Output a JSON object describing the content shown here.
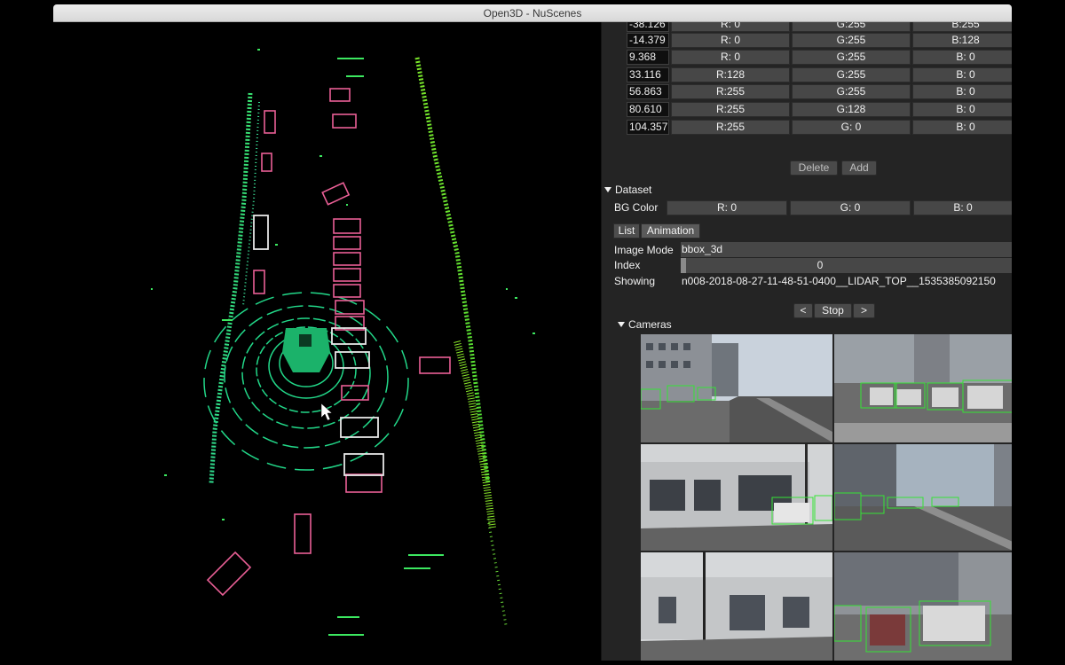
{
  "window": {
    "title": "Open3D - NuScenes"
  },
  "colormap": {
    "points": [
      {
        "value": "-38.126",
        "r": "R:  0",
        "g": "G:255",
        "b": "B:255"
      },
      {
        "value": "-14.379",
        "r": "R:  0",
        "g": "G:255",
        "b": "B:128"
      },
      {
        "value": "9.368",
        "r": "R:  0",
        "g": "G:255",
        "b": "B:  0"
      },
      {
        "value": "33.116",
        "r": "R:128",
        "g": "G:255",
        "b": "B:  0"
      },
      {
        "value": "56.863",
        "r": "R:255",
        "g": "G:255",
        "b": "B:  0"
      },
      {
        "value": "80.610",
        "r": "R:255",
        "g": "G:128",
        "b": "B:  0"
      },
      {
        "value": "104.357",
        "r": "R:255",
        "g": "G:  0",
        "b": "B:  0"
      }
    ],
    "delete_label": "Delete",
    "add_label": "Add"
  },
  "dataset": {
    "header": "Dataset",
    "bg_color_label": "BG Color",
    "bg_r": "R:  0",
    "bg_g": "G:  0",
    "bg_b": "B:  0"
  },
  "tabs": {
    "list": "List",
    "animation": "Animation"
  },
  "animation": {
    "image_mode_label": "Image Mode",
    "image_mode_value": "bbox_3d",
    "index_label": "Index",
    "index_value": "0",
    "showing_label": "Showing",
    "showing_value": "n008-2018-08-27-11-48-51-0400__LIDAR_TOP__1535385092150",
    "prev_label": "<",
    "stop_label": "Stop",
    "next_label": ">"
  },
  "cameras": {
    "header": "Cameras"
  }
}
